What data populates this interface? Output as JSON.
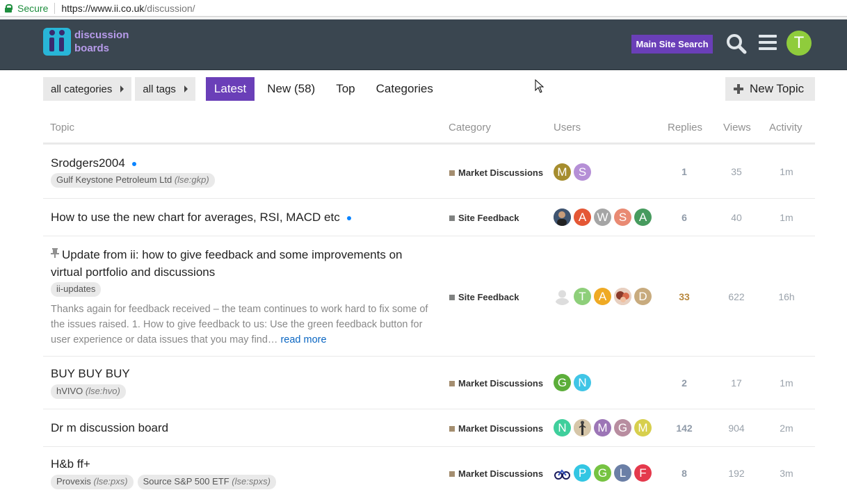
{
  "browser": {
    "secure_label": "Secure",
    "url_host": "https://www.ii.co.uk",
    "url_path": "/discussion/"
  },
  "header": {
    "logo_line1": "discussion",
    "logo_line2": "boards",
    "search_button": "Main Site Search",
    "user_initial": "T",
    "colors": {
      "bar": "#3a4650",
      "accent": "#6a3fb8",
      "user_avatar": "#8fcc3c"
    }
  },
  "nav": {
    "category_filter": "all categories",
    "tag_filter": "all tags",
    "tabs": [
      "Latest",
      "New (58)",
      "Top",
      "Categories"
    ],
    "new_topic": "New Topic"
  },
  "columns": {
    "topic": "Topic",
    "category": "Category",
    "users": "Users",
    "replies": "Replies",
    "views": "Views",
    "activity": "Activity"
  },
  "topics": [
    {
      "title": "Srodgers2004",
      "tags": [
        {
          "name": "Gulf Keystone Petroleum Ltd",
          "code": "(lse:gkp)"
        }
      ],
      "category": "Market Discussions",
      "avatars": [
        "M",
        "S"
      ],
      "replies": "1",
      "views": "35",
      "activity": "1m"
    },
    {
      "title": "How to use the new chart for averages, RSI, MACD etc",
      "category": "Site Feedback",
      "avatars": [
        "",
        "A",
        "W",
        "S",
        "A"
      ],
      "replies": "6",
      "views": "40",
      "activity": "1m"
    },
    {
      "title": "Update from ii: how to give feedback and some improvements on virtual portfolio and discussions",
      "tags": [
        {
          "name": "ii-updates",
          "code": ""
        }
      ],
      "excerpt": "Thanks again for feedback received – the team continues to work hard to fix some of the issues raised. 1. How to give feedback to us: Use the green feedback button for user experience or data issues that you may find…",
      "read_more": "read more",
      "category": "Site Feedback",
      "avatars": [
        "",
        "T",
        "A",
        "",
        "D"
      ],
      "replies": "33",
      "views": "622",
      "activity": "16h"
    },
    {
      "title": "BUY BUY BUY",
      "tags": [
        {
          "name": "hVIVO",
          "code": "(lse:hvo)"
        }
      ],
      "category": "Market Discussions",
      "avatars": [
        "G",
        "N"
      ],
      "replies": "2",
      "views": "17",
      "activity": "1m"
    },
    {
      "title": "Dr m discussion board",
      "category": "Market Discussions",
      "avatars": [
        "N",
        "",
        "M",
        "G",
        "M"
      ],
      "replies": "142",
      "views": "904",
      "activity": "2m"
    },
    {
      "title": "H&b ff+",
      "tags": [
        {
          "name": "Provexis",
          "code": "(lse:pxs)"
        },
        {
          "name": "Source S&P 500 ETF",
          "code": "(lse:spxs)"
        }
      ],
      "category": "Market Discussions",
      "avatars": [
        "",
        "P",
        "G",
        "L",
        "F"
      ],
      "replies": "8",
      "views": "192",
      "activity": "3m"
    }
  ]
}
